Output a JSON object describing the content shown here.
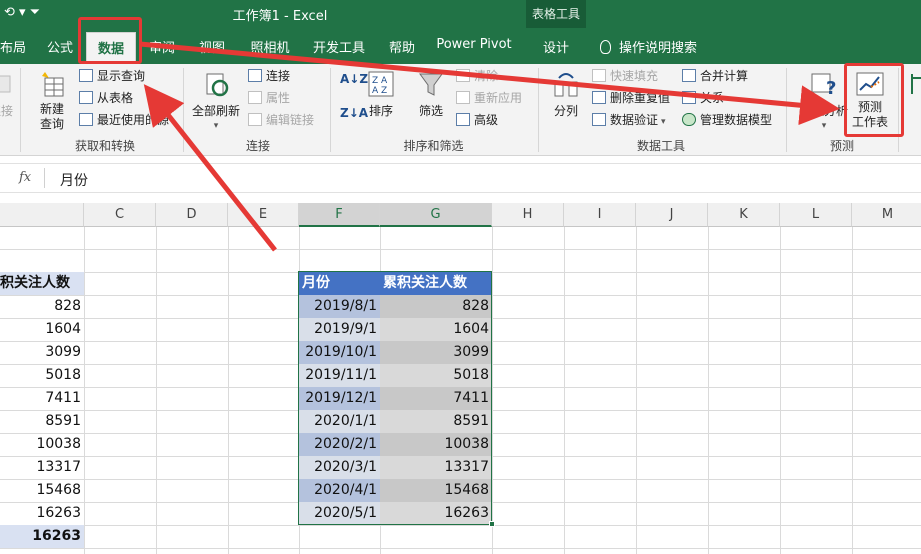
{
  "window": {
    "title": "工作簿1  -  Excel",
    "context_tab_title": "表格工具"
  },
  "tabs": [
    {
      "label": "布局"
    },
    {
      "label": "公式"
    },
    {
      "label": "数据",
      "active": true
    },
    {
      "label": "审阅"
    },
    {
      "label": "视图"
    },
    {
      "label": "照相机"
    },
    {
      "label": "开发工具"
    },
    {
      "label": "帮助"
    },
    {
      "label": "Power Pivot"
    },
    {
      "label": "设计"
    }
  ],
  "tell_me": "操作说明搜索",
  "ribbon": {
    "get_transform": {
      "label": "获取和转换",
      "partial_button": "连接",
      "new_query": "新建\n查询",
      "show_queries": "显示查询",
      "from_table": "从表格",
      "recent_sources": "最近使用的源"
    },
    "connections": {
      "label": "连接",
      "refresh_all": "全部刷新",
      "connections": "连接",
      "properties": "属性",
      "edit_links": "编辑链接"
    },
    "sort_filter": {
      "label": "排序和筛选",
      "sort": "排序",
      "filter": "筛选",
      "clear": "清除",
      "reapply": "重新应用",
      "advanced": "高级"
    },
    "data_tools": {
      "label": "数据工具",
      "text_to_columns": "分列",
      "flash_fill": "快速填充",
      "remove_duplicates": "删除重复值",
      "data_validation": "数据验证",
      "consolidate": "合并计算",
      "relationships": "关系",
      "manage_model": "管理数据模型"
    },
    "forecast": {
      "label": "预测",
      "what_if": "模拟分析",
      "forecast_sheet": "预测\n工作表"
    }
  },
  "formula_bar": {
    "fx": "fx",
    "value": "月份"
  },
  "columns": [
    "C",
    "D",
    "E",
    "F",
    "G",
    "H",
    "I",
    "J",
    "K",
    "L",
    "M"
  ],
  "left_partial": {
    "header": "积关注人数",
    "values": [
      "828",
      "1604",
      "3099",
      "5018",
      "7411",
      "8591",
      "10038",
      "13317",
      "15468",
      "16263"
    ],
    "total": "16263"
  },
  "table": {
    "headers": [
      "月份",
      "累积关注人数"
    ],
    "rows": [
      [
        "2019/8/1",
        "828"
      ],
      [
        "2019/9/1",
        "1604"
      ],
      [
        "2019/10/1",
        "3099"
      ],
      [
        "2019/11/1",
        "5018"
      ],
      [
        "2019/12/1",
        "7411"
      ],
      [
        "2020/1/1",
        "8591"
      ],
      [
        "2020/2/1",
        "10038"
      ],
      [
        "2020/3/1",
        "13317"
      ],
      [
        "2020/4/1",
        "15468"
      ],
      [
        "2020/5/1",
        "16263"
      ]
    ]
  },
  "colors": {
    "excel_green": "#217346",
    "table_header": "#4472c4",
    "annotation_red": "#e53935"
  }
}
